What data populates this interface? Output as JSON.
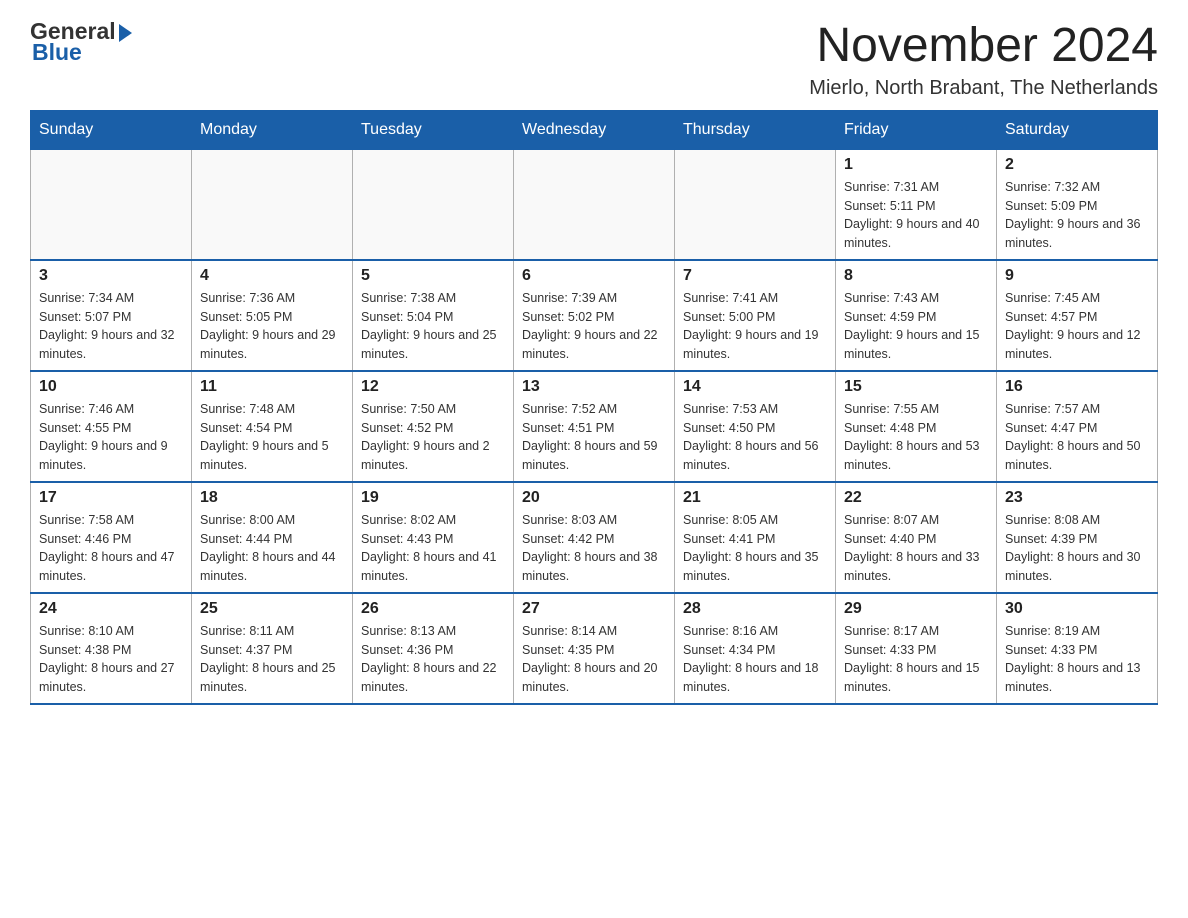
{
  "logo": {
    "general": "General",
    "blue": "Blue"
  },
  "title": "November 2024",
  "subtitle": "Mierlo, North Brabant, The Netherlands",
  "weekdays": [
    "Sunday",
    "Monday",
    "Tuesday",
    "Wednesday",
    "Thursday",
    "Friday",
    "Saturday"
  ],
  "weeks": [
    [
      {
        "day": "",
        "info": ""
      },
      {
        "day": "",
        "info": ""
      },
      {
        "day": "",
        "info": ""
      },
      {
        "day": "",
        "info": ""
      },
      {
        "day": "",
        "info": ""
      },
      {
        "day": "1",
        "info": "Sunrise: 7:31 AM\nSunset: 5:11 PM\nDaylight: 9 hours and 40 minutes."
      },
      {
        "day": "2",
        "info": "Sunrise: 7:32 AM\nSunset: 5:09 PM\nDaylight: 9 hours and 36 minutes."
      }
    ],
    [
      {
        "day": "3",
        "info": "Sunrise: 7:34 AM\nSunset: 5:07 PM\nDaylight: 9 hours and 32 minutes."
      },
      {
        "day": "4",
        "info": "Sunrise: 7:36 AM\nSunset: 5:05 PM\nDaylight: 9 hours and 29 minutes."
      },
      {
        "day": "5",
        "info": "Sunrise: 7:38 AM\nSunset: 5:04 PM\nDaylight: 9 hours and 25 minutes."
      },
      {
        "day": "6",
        "info": "Sunrise: 7:39 AM\nSunset: 5:02 PM\nDaylight: 9 hours and 22 minutes."
      },
      {
        "day": "7",
        "info": "Sunrise: 7:41 AM\nSunset: 5:00 PM\nDaylight: 9 hours and 19 minutes."
      },
      {
        "day": "8",
        "info": "Sunrise: 7:43 AM\nSunset: 4:59 PM\nDaylight: 9 hours and 15 minutes."
      },
      {
        "day": "9",
        "info": "Sunrise: 7:45 AM\nSunset: 4:57 PM\nDaylight: 9 hours and 12 minutes."
      }
    ],
    [
      {
        "day": "10",
        "info": "Sunrise: 7:46 AM\nSunset: 4:55 PM\nDaylight: 9 hours and 9 minutes."
      },
      {
        "day": "11",
        "info": "Sunrise: 7:48 AM\nSunset: 4:54 PM\nDaylight: 9 hours and 5 minutes."
      },
      {
        "day": "12",
        "info": "Sunrise: 7:50 AM\nSunset: 4:52 PM\nDaylight: 9 hours and 2 minutes."
      },
      {
        "day": "13",
        "info": "Sunrise: 7:52 AM\nSunset: 4:51 PM\nDaylight: 8 hours and 59 minutes."
      },
      {
        "day": "14",
        "info": "Sunrise: 7:53 AM\nSunset: 4:50 PM\nDaylight: 8 hours and 56 minutes."
      },
      {
        "day": "15",
        "info": "Sunrise: 7:55 AM\nSunset: 4:48 PM\nDaylight: 8 hours and 53 minutes."
      },
      {
        "day": "16",
        "info": "Sunrise: 7:57 AM\nSunset: 4:47 PM\nDaylight: 8 hours and 50 minutes."
      }
    ],
    [
      {
        "day": "17",
        "info": "Sunrise: 7:58 AM\nSunset: 4:46 PM\nDaylight: 8 hours and 47 minutes."
      },
      {
        "day": "18",
        "info": "Sunrise: 8:00 AM\nSunset: 4:44 PM\nDaylight: 8 hours and 44 minutes."
      },
      {
        "day": "19",
        "info": "Sunrise: 8:02 AM\nSunset: 4:43 PM\nDaylight: 8 hours and 41 minutes."
      },
      {
        "day": "20",
        "info": "Sunrise: 8:03 AM\nSunset: 4:42 PM\nDaylight: 8 hours and 38 minutes."
      },
      {
        "day": "21",
        "info": "Sunrise: 8:05 AM\nSunset: 4:41 PM\nDaylight: 8 hours and 35 minutes."
      },
      {
        "day": "22",
        "info": "Sunrise: 8:07 AM\nSunset: 4:40 PM\nDaylight: 8 hours and 33 minutes."
      },
      {
        "day": "23",
        "info": "Sunrise: 8:08 AM\nSunset: 4:39 PM\nDaylight: 8 hours and 30 minutes."
      }
    ],
    [
      {
        "day": "24",
        "info": "Sunrise: 8:10 AM\nSunset: 4:38 PM\nDaylight: 8 hours and 27 minutes."
      },
      {
        "day": "25",
        "info": "Sunrise: 8:11 AM\nSunset: 4:37 PM\nDaylight: 8 hours and 25 minutes."
      },
      {
        "day": "26",
        "info": "Sunrise: 8:13 AM\nSunset: 4:36 PM\nDaylight: 8 hours and 22 minutes."
      },
      {
        "day": "27",
        "info": "Sunrise: 8:14 AM\nSunset: 4:35 PM\nDaylight: 8 hours and 20 minutes."
      },
      {
        "day": "28",
        "info": "Sunrise: 8:16 AM\nSunset: 4:34 PM\nDaylight: 8 hours and 18 minutes."
      },
      {
        "day": "29",
        "info": "Sunrise: 8:17 AM\nSunset: 4:33 PM\nDaylight: 8 hours and 15 minutes."
      },
      {
        "day": "30",
        "info": "Sunrise: 8:19 AM\nSunset: 4:33 PM\nDaylight: 8 hours and 13 minutes."
      }
    ]
  ]
}
